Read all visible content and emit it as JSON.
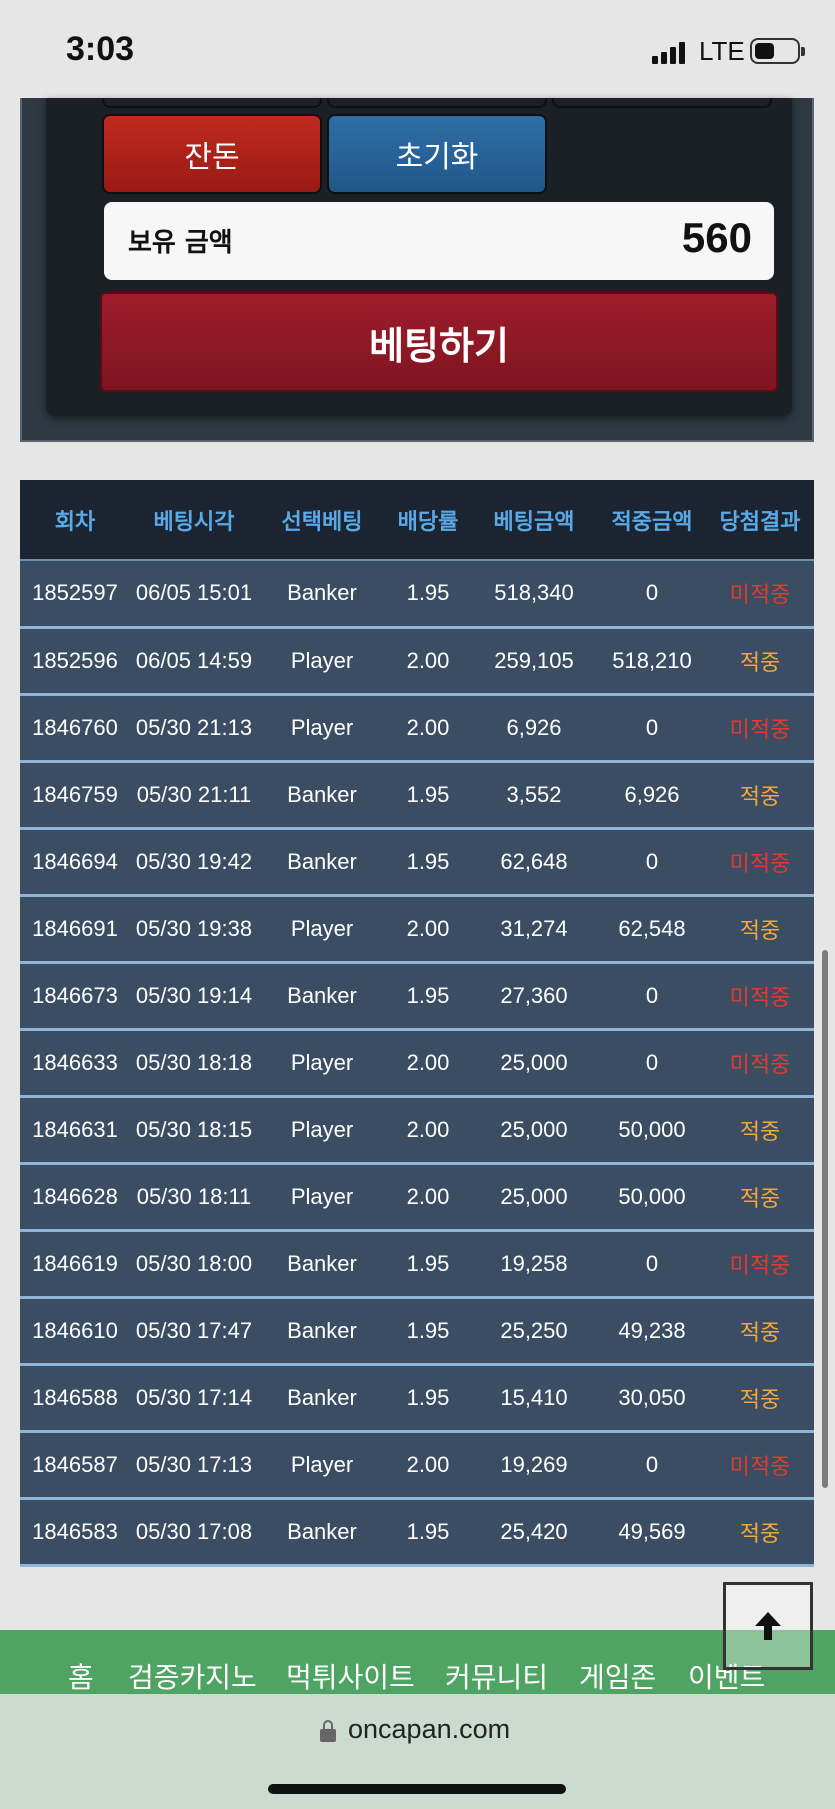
{
  "status_bar": {
    "time": "3:03",
    "network": "LTE",
    "icons": [
      "signal-icon",
      "battery-icon"
    ]
  },
  "bet_panel": {
    "buttons": [
      {
        "label": "잔돈",
        "color": "#b3241a"
      },
      {
        "label": "초기화",
        "color": "#2a659d"
      }
    ],
    "balance_label": "보유 금액",
    "balance_value": "560",
    "submit_label": "베팅하기",
    "submit_color": "#8c1826"
  },
  "history": {
    "columns": [
      "회차",
      "베팅시각",
      "선택베팅",
      "배당률",
      "베팅금액",
      "적중금액",
      "당첨결과"
    ],
    "rows": [
      [
        "1852597",
        "06/05 15:01",
        "Banker",
        "1.95",
        "518,340",
        "0",
        "미적중"
      ],
      [
        "1852596",
        "06/05 14:59",
        "Player",
        "2.00",
        "259,105",
        "518,210",
        "적중"
      ],
      [
        "1846760",
        "05/30 21:13",
        "Player",
        "2.00",
        "6,926",
        "0",
        "미적중"
      ],
      [
        "1846759",
        "05/30 21:11",
        "Banker",
        "1.95",
        "3,552",
        "6,926",
        "적중"
      ],
      [
        "1846694",
        "05/30 19:42",
        "Banker",
        "1.95",
        "62,648",
        "0",
        "미적중"
      ],
      [
        "1846691",
        "05/30 19:38",
        "Player",
        "2.00",
        "31,274",
        "62,548",
        "적중"
      ],
      [
        "1846673",
        "05/30 19:14",
        "Banker",
        "1.95",
        "27,360",
        "0",
        "미적중"
      ],
      [
        "1846633",
        "05/30 18:18",
        "Player",
        "2.00",
        "25,000",
        "0",
        "미적중"
      ],
      [
        "1846631",
        "05/30 18:15",
        "Player",
        "2.00",
        "25,000",
        "50,000",
        "적중"
      ],
      [
        "1846628",
        "05/30 18:11",
        "Player",
        "2.00",
        "25,000",
        "50,000",
        "적중"
      ],
      [
        "1846619",
        "05/30 18:00",
        "Banker",
        "1.95",
        "19,258",
        "0",
        "미적중"
      ],
      [
        "1846610",
        "05/30 17:47",
        "Banker",
        "1.95",
        "25,250",
        "49,238",
        "적중"
      ],
      [
        "1846588",
        "05/30 17:14",
        "Banker",
        "1.95",
        "15,410",
        "30,050",
        "적중"
      ],
      [
        "1846587",
        "05/30 17:13",
        "Player",
        "2.00",
        "19,269",
        "0",
        "미적중"
      ],
      [
        "1846583",
        "05/30 17:08",
        "Banker",
        "1.95",
        "25,420",
        "49,569",
        "적중"
      ]
    ],
    "colors": {
      "header_text": "#5aa9e6",
      "row_bg": "#3a4d63",
      "lose": "#e23a2c",
      "win": "#f2a83b"
    }
  },
  "scroll_top_icon": "arrow-up-icon",
  "bottom_nav": {
    "items": [
      "홈",
      "검증카지노",
      "먹튀사이트",
      "커뮤니티",
      "게임존",
      "이벤트"
    ],
    "color": "#4fa463"
  },
  "browser": {
    "url": "oncapan.com",
    "icon": "lock-icon"
  }
}
